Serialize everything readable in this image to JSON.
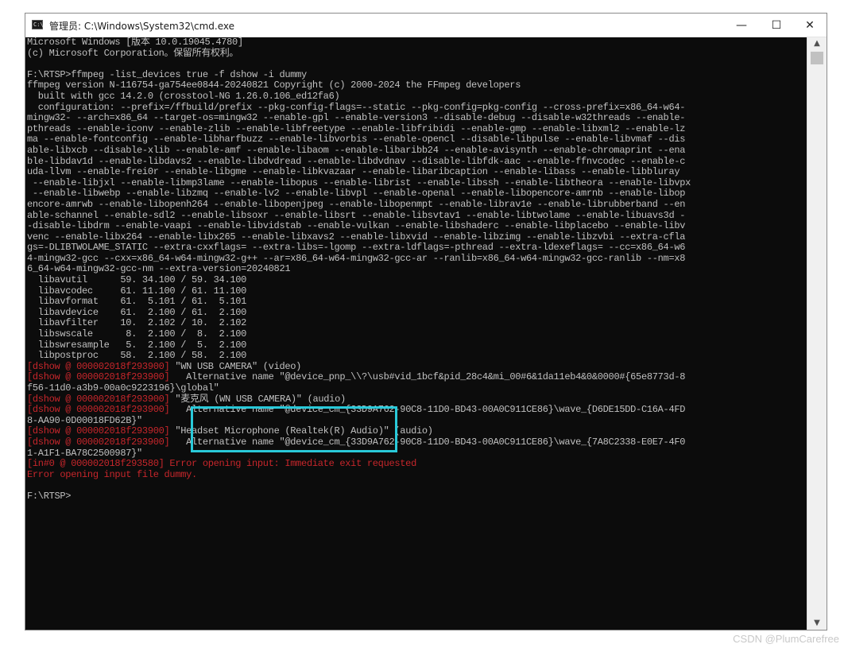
{
  "window": {
    "title": "管理员: C:\\Windows\\System32\\cmd.exe",
    "minimize_glyph": "—",
    "maximize_glyph": "☐",
    "close_glyph": "✕"
  },
  "scrollbar": {
    "up": "▲",
    "down": "▼"
  },
  "console": {
    "text_color": "#c0c0c0",
    "error_color": "#c7262b",
    "background": "#0c0c0c",
    "lines": [
      {
        "text": "Microsoft Windows [版本 10.0.19045.4780]"
      },
      {
        "text": "(c) Microsoft Corporation。保留所有权利。"
      },
      {
        "text": ""
      },
      {
        "text": "F:\\RTSP>ffmpeg -list_devices true -f dshow -i dummy"
      },
      {
        "text": "ffmpeg version N-116754-ga754ee0844-20240821 Copyright (c) 2000-2024 the FFmpeg developers"
      },
      {
        "text": "  built with gcc 14.2.0 (crosstool-NG 1.26.0.106_ed12fa6)"
      },
      {
        "text": "  configuration: --prefix=/ffbuild/prefix --pkg-config-flags=--static --pkg-config=pkg-config --cross-prefix=x86_64-w64-"
      },
      {
        "text": "mingw32- --arch=x86_64 --target-os=mingw32 --enable-gpl --enable-version3 --disable-debug --disable-w32threads --enable-"
      },
      {
        "text": "pthreads --enable-iconv --enable-zlib --enable-libfreetype --enable-libfribidi --enable-gmp --enable-libxml2 --enable-lz"
      },
      {
        "text": "ma --enable-fontconfig --enable-libharfbuzz --enable-libvorbis --enable-opencl --disable-libpulse --enable-libvmaf --dis"
      },
      {
        "text": "able-libxcb --disable-xlib --enable-amf --enable-libaom --enable-libaribb24 --enable-avisynth --enable-chromaprint --ena"
      },
      {
        "text": "ble-libdav1d --enable-libdavs2 --enable-libdvdread --enable-libdvdnav --disable-libfdk-aac --enable-ffnvcodec --enable-c"
      },
      {
        "text": "uda-llvm --enable-frei0r --enable-libgme --enable-libkvazaar --enable-libaribcaption --enable-libass --enable-libbluray"
      },
      {
        "text": " --enable-libjxl --enable-libmp3lame --enable-libopus --enable-librist --enable-libssh --enable-libtheora --enable-libvpx"
      },
      {
        "text": " --enable-libwebp --enable-libzmq --enable-lv2 --enable-libvpl --enable-openal --enable-libopencore-amrnb --enable-libop"
      },
      {
        "text": "encore-amrwb --enable-libopenh264 --enable-libopenjpeg --enable-libopenmpt --enable-librav1e --enable-librubberband --en"
      },
      {
        "text": "able-schannel --enable-sdl2 --enable-libsoxr --enable-libsrt --enable-libsvtav1 --enable-libtwolame --enable-libuavs3d -"
      },
      {
        "text": "-disable-libdrm --enable-vaapi --enable-libvidstab --enable-vulkan --enable-libshaderc --enable-libplacebo --enable-libv"
      },
      {
        "text": "venc --enable-libx264 --enable-libx265 --enable-libxavs2 --enable-libxvid --enable-libzimg --enable-libzvbi --extra-cfla"
      },
      {
        "text": "gs=-DLIBTWOLAME_STATIC --extra-cxxflags= --extra-libs=-lgomp --extra-ldflags=-pthread --extra-ldexeflags= --cc=x86_64-w6"
      },
      {
        "text": "4-mingw32-gcc --cxx=x86_64-w64-mingw32-g++ --ar=x86_64-w64-mingw32-gcc-ar --ranlib=x86_64-w64-mingw32-gcc-ranlib --nm=x8"
      },
      {
        "text": "6_64-w64-mingw32-gcc-nm --extra-version=20240821"
      },
      {
        "text": "  libavutil      59. 34.100 / 59. 34.100"
      },
      {
        "text": "  libavcodec     61. 11.100 / 61. 11.100"
      },
      {
        "text": "  libavformat    61.  5.101 / 61.  5.101"
      },
      {
        "text": "  libavdevice    61.  2.100 / 61.  2.100"
      },
      {
        "text": "  libavfilter    10.  2.102 / 10.  2.102"
      },
      {
        "text": "  libswscale      8.  2.100 /  8.  2.100"
      },
      {
        "text": "  libswresample   5.  2.100 /  5.  2.100"
      },
      {
        "text": "  libpostproc    58.  2.100 / 58.  2.100"
      },
      {
        "prefix": "[dshow @ 000002018f293900] ",
        "text": "\"WN USB CAMERA\" (video)"
      },
      {
        "prefix": "[dshow @ 000002018f293900] ",
        "text": "  Alternative name \"@device_pnp_\\\\?\\usb#vid_1bcf&pid_28c4&mi_00#6&1da11eb4&0&0000#{65e8773d-8"
      },
      {
        "text": "f56-11d0-a3b9-00a0c9223196}\\global\""
      },
      {
        "prefix": "[dshow @ 000002018f293900] ",
        "text": "\"麦克风 (WN USB CAMERA)\" (audio)"
      },
      {
        "prefix": "[dshow @ 000002018f293900] ",
        "text": "  Alternative name \"@device_cm_{33D9A762-90C8-11D0-BD43-00A0C911CE86}\\wave_{D6DE15DD-C16A-4FD"
      },
      {
        "text": "8-AA90-0D00018FD62B}\""
      },
      {
        "prefix": "[dshow @ 000002018f293900] ",
        "text": "\"Headset Microphone (Realtek(R) Audio)\" (audio)"
      },
      {
        "prefix": "[dshow @ 000002018f293900] ",
        "text": "  Alternative name \"@device_cm_{33D9A762-90C8-11D0-BD43-00A0C911CE86}\\wave_{7A8C2338-E0E7-4F0"
      },
      {
        "text": "1-A1F1-BA78C2500987}\""
      },
      {
        "red": true,
        "text": "[in#0 @ 000002018f293580] Error opening input: Immediate exit requested"
      },
      {
        "red": true,
        "text": "Error opening input file dummy."
      },
      {
        "text": ""
      },
      {
        "text": "F:\\RTSP>"
      }
    ]
  },
  "watermark": "CSDN @PlumCarefree",
  "highlight_color": "#29c9d9"
}
